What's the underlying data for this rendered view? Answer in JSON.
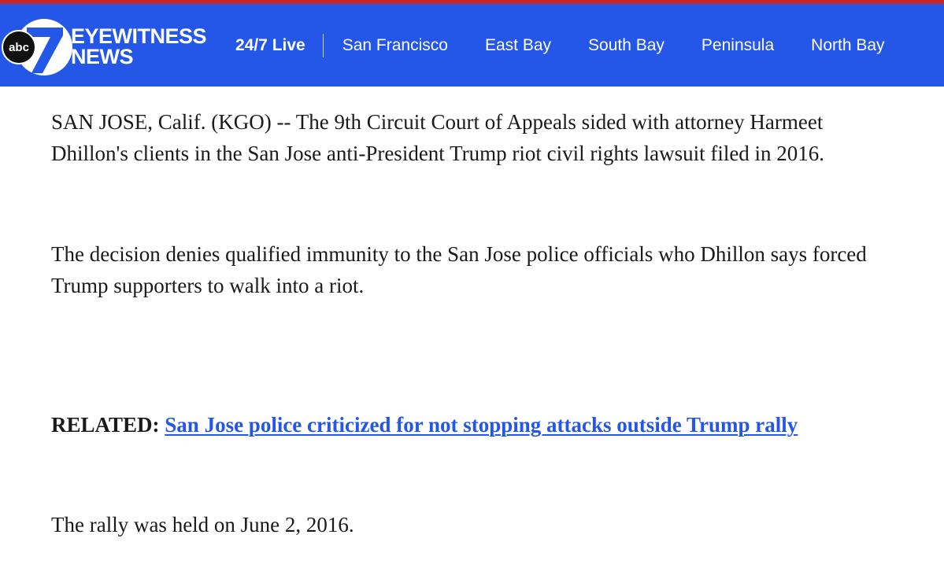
{
  "header": {
    "logo": {
      "badge_text": "abc",
      "numeral": "7",
      "line1": "EYEWITNESS",
      "line2": "NEWS"
    },
    "live_label": "24/7 Live",
    "nav_items": [
      {
        "label": "San Francisco"
      },
      {
        "label": "East Bay"
      },
      {
        "label": "South Bay"
      },
      {
        "label": "Peninsula"
      },
      {
        "label": "North Bay"
      }
    ]
  },
  "article": {
    "paragraph1": "SAN JOSE, Calif. (KGO) -- The 9th Circuit Court of Appeals sided with attorney Harmeet Dhillon's clients in the San Jose anti-President Trump riot civil rights lawsuit filed in 2016.",
    "paragraph2": "The decision denies qualified immunity to the San Jose police officials who Dhillon says forced Trump supporters to walk into a riot.",
    "related_label": "RELATED:",
    "related_link": "San Jose police criticized for not stopping attacks outside Trump rally",
    "paragraph3": "The rally was held on June 2, 2016."
  },
  "colors": {
    "nav_background": "#2456e8",
    "top_stripe": "#c62828",
    "link": "#2456e8",
    "text": "#1a1a1a"
  },
  "icons": [
    "abc-7-logo"
  ]
}
